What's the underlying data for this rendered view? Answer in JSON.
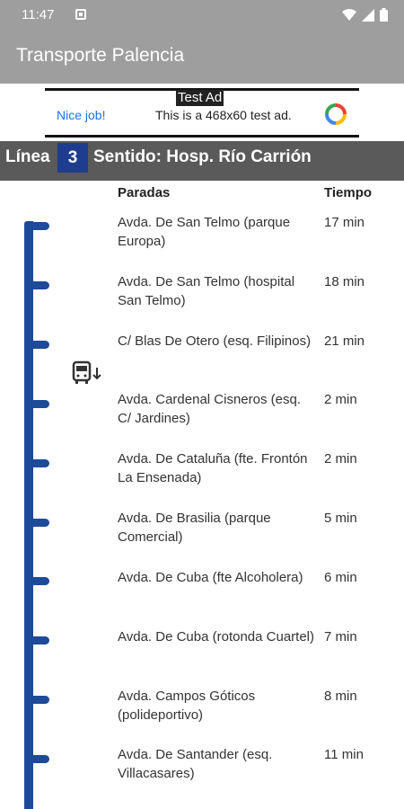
{
  "status": {
    "time": "11:47"
  },
  "app": {
    "title": "Transporte Palencia"
  },
  "ad": {
    "badge": "Test Ad",
    "nice": "Nice job!",
    "text": "This is a 468x60 test ad."
  },
  "line": {
    "label": "Línea",
    "number": "3",
    "direction": "Sentido: Hosp. Río Carrión"
  },
  "table": {
    "col_stops": "Paradas",
    "col_time": "Tiempo",
    "rows": [
      {
        "stop": "Avda. De San Telmo (parque Europa)",
        "time": "17 min"
      },
      {
        "stop": "Avda. De San Telmo (hospital San Telmo)",
        "time": "18 min"
      },
      {
        "stop": "C/ Blas De Otero (esq. Filipinos)",
        "time": "21 min"
      },
      {
        "stop": "Avda. Cardenal Cisneros (esq. C/ Jardines)",
        "time": "2 min"
      },
      {
        "stop": "Avda. De Cataluña (fte. Frontón La Ensenada)",
        "time": "2 min"
      },
      {
        "stop": "Avda. De Brasilia (parque Comercial)",
        "time": "5 min"
      },
      {
        "stop": "Avda. De Cuba (fte Alcoholera)",
        "time": "6 min"
      },
      {
        "stop": "Avda. De Cuba (rotonda Cuartel)",
        "time": "7 min"
      },
      {
        "stop": "Avda. Campos Góticos (polideportivo)",
        "time": "8 min"
      },
      {
        "stop": "Avda. De Santander (esq. Villacasares)",
        "time": "11 min"
      }
    ]
  },
  "colors": {
    "appbar": "#9e9e9e",
    "line_badge": "#1e3d8f",
    "route": "#1e4a9a",
    "line_bar": "#5a5a5a"
  },
  "icons": {
    "bus": "bus-arriving-icon"
  }
}
